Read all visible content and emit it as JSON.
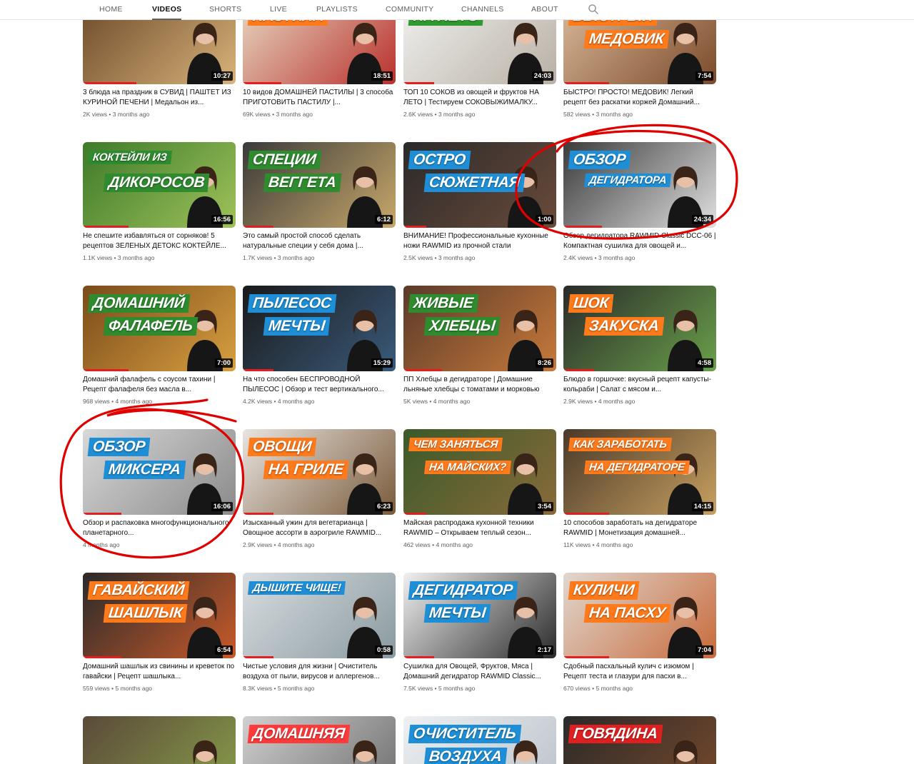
{
  "tabs": [
    {
      "id": "home",
      "label": "HOME"
    },
    {
      "id": "videos",
      "label": "VIDEOS",
      "active": true
    },
    {
      "id": "shorts",
      "label": "SHORTS"
    },
    {
      "id": "live",
      "label": "LIVE"
    },
    {
      "id": "playlists",
      "label": "PLAYLISTS"
    },
    {
      "id": "community",
      "label": "COMMUNITY"
    },
    {
      "id": "channels",
      "label": "CHANNELS"
    },
    {
      "id": "about",
      "label": "ABOUT"
    }
  ],
  "accent_color": "#e02020",
  "annotation_color": "#e00000",
  "rows": [
    [
      {
        "caption": [
          "",
          ""
        ],
        "duration": "10:27",
        "title": "3 блюда на праздник в СУВИД | ПАШТЕТ ИЗ КУРИНОЙ ПЕЧЕНИ | Медальон из...",
        "views": "2K views",
        "date": "3 months ago",
        "colors": [
          "#6d4a2b",
          "#d8b37a"
        ],
        "cap_color": "#ff7a1a",
        "watched": 0.35
      },
      {
        "caption": [
          "ПАСТИЛА",
          ""
        ],
        "duration": "18:51",
        "title": "10 видов ДОМАШНЕЙ ПАСТИЛЫ | 3 способа ПРИГОТОВИТЬ ПАСТИЛУ |...",
        "views": "69K views",
        "date": "3 months ago",
        "colors": [
          "#e6d8c2",
          "#b9302c"
        ],
        "cap_color": "#ff7a1a",
        "watched": 0.25
      },
      {
        "caption": [
          "НА ЛЕТО",
          ""
        ],
        "duration": "24:03",
        "title": "ТОП 10 СОКОВ из овощей и фруктов НА ЛЕТО | Тестируем СОКОВЫЖИМАЛКУ...",
        "views": "2.6K views",
        "date": "3 months ago",
        "colors": [
          "#f0f0ee",
          "#b8b0a5"
        ],
        "cap_color": "#2f9a2f",
        "watched": 0.2
      },
      {
        "caption": [
          "БЫСТРЫЙ",
          "МЕДОВИК"
        ],
        "duration": "7:54",
        "title": "БЫСТРО! ПРОСТО! МЕДОВИК! Легкий рецепт без раскатки коржей Домашний...",
        "views": "582 views",
        "date": "3 months ago",
        "colors": [
          "#d9b99a",
          "#7a4a2a"
        ],
        "cap_color": "#ff7a1a",
        "watched": 0.3
      }
    ],
    [
      {
        "caption": [
          "КОКТЕЙЛИ ИЗ",
          "ДИКОРОСОВ"
        ],
        "duration": "16:56",
        "title": "Не спешите избавляться от сорняков! 5 рецептов ЗЕЛЕНЫХ ДЕТОКС КОКТЕЙЛЕ...",
        "views": "1.1K views",
        "date": "3 months ago",
        "colors": [
          "#3e7a2a",
          "#9fc25a"
        ],
        "cap_color": "#2e8b2e",
        "watched": 0.3
      },
      {
        "caption": [
          "СПЕЦИИ",
          "ВЕГГЕТА"
        ],
        "duration": "6:12",
        "title": "Это самый простой способ сделать натуральные специи у себя дома |...",
        "views": "1.7K views",
        "date": "3 months ago",
        "colors": [
          "#3a3a3a",
          "#c8a86a"
        ],
        "cap_color": "#2e8b2e",
        "watched": 0.2
      },
      {
        "caption": [
          "ОСТРО",
          "СЮЖЕТНАЯ"
        ],
        "duration": "1:00",
        "title": "ВНИМАНИЕ! Профессиональные кухонные ножи RAWMID из прочной стали",
        "views": "2.5K views",
        "date": "3 months ago",
        "colors": [
          "#2a2a2a",
          "#6a4a3a"
        ],
        "cap_color": "#1e8fd6",
        "watched": 0.15
      },
      {
        "caption": [
          "ОБЗОР",
          "ДЕГИДРАТОРА"
        ],
        "duration": "24:34",
        "title": "Обзор дегидратора RAWMID Classic DCC-06 | Компактная сушилка для овощей и...",
        "views": "2.4K views",
        "date": "3 months ago",
        "colors": [
          "#3b3b3b",
          "#e0e0e0"
        ],
        "cap_color": "#1e8fd6",
        "watched": 0.25
      }
    ],
    [
      {
        "caption": [
          "ДОМАШНИЙ",
          "ФАЛАФЕЛЬ"
        ],
        "duration": "7:00",
        "title": "Домашний фалафель с соусом тахини | Рецепт фалафеля без масла в...",
        "views": "968 views",
        "date": "4 months ago",
        "colors": [
          "#7a4a1a",
          "#d8a040"
        ],
        "cap_color": "#2e8b2e",
        "watched": 0.3
      },
      {
        "caption": [
          "ПЫЛЕСОС",
          "МЕЧТЫ"
        ],
        "duration": "15:29",
        "title": "На что способен БЕСПРОВОДНОЙ ПЫЛЕСОС | Обзор и тест вертикального...",
        "views": "4.2K views",
        "date": "4 months ago",
        "colors": [
          "#1a1a1a",
          "#3a5a7a"
        ],
        "cap_color": "#1e8fd6",
        "watched": 0.2
      },
      {
        "caption": [
          "ЖИВЫЕ",
          "ХЛЕБЦЫ"
        ],
        "duration": "8:26",
        "title": "ПП Хлебцы в дегидраторе | Домашние льняные хлебцы с томатами и морковью",
        "views": "5K views",
        "date": "4 months ago",
        "colors": [
          "#5a3a2a",
          "#c87a3a"
        ],
        "cap_color": "#2e8b2e",
        "watched": 0.25
      },
      {
        "caption": [
          "ШОК",
          "ЗАКУСКА"
        ],
        "duration": "4:58",
        "title": "Блюдо в горшочке: вкусный рецепт капусты-кольраби | Салат с мясом и...",
        "views": "2.9K views",
        "date": "4 months ago",
        "colors": [
          "#2a2a2a",
          "#6aa04a"
        ],
        "cap_color": "#ff7a1a",
        "watched": 0.2
      }
    ],
    [
      {
        "caption": [
          "ОБЗОР",
          "МИКСЕРА"
        ],
        "duration": "16:06",
        "title": "Обзор и распаковка многофункционального планетарного...",
        "views": "",
        "date": "4 months ago",
        "colors": [
          "#d8d8d8",
          "#8a8a8a"
        ],
        "cap_color": "#1e8fd6",
        "watched": 0.25
      },
      {
        "caption": [
          "ОВОЩИ",
          "НА ГРИЛЕ"
        ],
        "duration": "6:23",
        "title": "Изысканный ужин для вегетарианца | Овощное ассорти в аэрогриле RAWMID...",
        "views": "2.9K views",
        "date": "4 months ago",
        "colors": [
          "#e8e4e0",
          "#7a5a3a"
        ],
        "cap_color": "#ff7a1a",
        "watched": 0.2
      },
      {
        "caption": [
          "ЧЕМ ЗАНЯТЬСЯ",
          "НА МАЙСКИХ?"
        ],
        "duration": "3:54",
        "title": "Майская распродажа кухонной техники RAWMID – Открываем теплый сезон...",
        "views": "462 views",
        "date": "4 months ago",
        "colors": [
          "#3a5a2a",
          "#8a6a3a"
        ],
        "cap_color": "#ff7a1a",
        "watched": 0.15
      },
      {
        "caption": [
          "КАК ЗАРАБОТАТЬ",
          "НА ДЕГИДРАТОРЕ"
        ],
        "duration": "14:15",
        "title": "10 способов заработать на дегидраторе RAWMID | Монетизация домашней...",
        "views": "11K views",
        "date": "4 months ago",
        "colors": [
          "#4a3a2a",
          "#c8a060"
        ],
        "cap_color": "#ff7a1a",
        "watched": 0.3
      }
    ],
    [
      {
        "caption": [
          "ГАВАЙСКИЙ",
          "ШАШЛЫК"
        ],
        "duration": "6:54",
        "title": "Домашний шашлык из свинины и креветок по гавайски | Рецепт шашлыка...",
        "views": "559 views",
        "date": "5 months ago",
        "colors": [
          "#2a2a2a",
          "#c85a2a"
        ],
        "cap_color": "#ff7a1a",
        "watched": 0.25
      },
      {
        "caption": [
          "ДЫШИТЕ ЧИЩЕ!",
          ""
        ],
        "duration": "0:58",
        "title": "Чистые условия для жизни | Очиститель воздуха от пыли, вирусов и аллергенов...",
        "views": "8.3K views",
        "date": "5 months ago",
        "colors": [
          "#d8dde0",
          "#8a9aa0"
        ],
        "cap_color": "#1e8fd6",
        "watched": 0.2
      },
      {
        "caption": [
          "ДЕГИДРАТОР",
          "МЕЧТЫ"
        ],
        "duration": "2:17",
        "title": "Сушилка для Овощей, Фруктов, Мяса | Домашний дегидратор RAWMID Classic...",
        "views": "7.5K views",
        "date": "5 months ago",
        "colors": [
          "#f0f0f0",
          "#2a2a2a"
        ],
        "cap_color": "#1e8fd6",
        "watched": 0.2
      },
      {
        "caption": [
          "КУЛИЧИ",
          "НА ПАСХУ"
        ],
        "duration": "7:04",
        "title": "Сдобный пасхальный кулич с изюмом | Рецепт теста и глазури для пасхи в...",
        "views": "670 views",
        "date": "5 months ago",
        "colors": [
          "#e0d8d0",
          "#c86a3a"
        ],
        "cap_color": "#ff7a1a",
        "watched": 0.3
      }
    ],
    [
      {
        "caption": [
          "",
          ""
        ],
        "duration": "",
        "title": "",
        "views": "",
        "date": "",
        "colors": [
          "#5a4a3a",
          "#8aa04a"
        ],
        "cap_color": "#ff7a1a",
        "watched": 0
      },
      {
        "caption": [
          "ДОМАШНЯЯ",
          ""
        ],
        "duration": "",
        "title": "",
        "views": "",
        "date": "",
        "colors": [
          "#d0d0d0",
          "#6a6a6a"
        ],
        "cap_color": "#ff3a3a",
        "watched": 0
      },
      {
        "caption": [
          "ОЧИСТИТЕЛЬ",
          "ВОЗДУХА"
        ],
        "duration": "",
        "title": "",
        "views": "",
        "date": "",
        "colors": [
          "#eef0f2",
          "#b8c0c8"
        ],
        "cap_color": "#1e8fd6",
        "watched": 0
      },
      {
        "caption": [
          "ГОВЯДИНА",
          ""
        ],
        "duration": "",
        "title": "",
        "views": "",
        "date": "",
        "colors": [
          "#2a2a2a",
          "#7a4a2a"
        ],
        "cap_color": "#e02020",
        "watched": 0
      }
    ]
  ]
}
